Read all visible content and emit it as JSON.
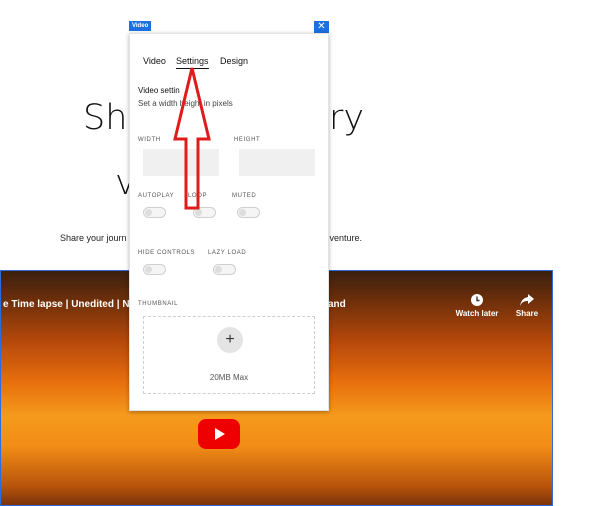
{
  "background": {
    "heading_left": "Sha",
    "heading_right": "ry",
    "heading_line2": "v",
    "subtext_left": "Share your journ",
    "subtext_right": "our venture."
  },
  "video": {
    "title": "e Time lapse | Unedited | N",
    "title_right": "and",
    "watch_later": "Watch later",
    "share": "Share"
  },
  "panel": {
    "tag": "Video",
    "close": "✕",
    "tabs": [
      "Video",
      "Settings",
      "Design"
    ],
    "active_tab": "Settings",
    "section_title": "Video settin",
    "section_subtitle": "Set a width  height in pixels",
    "width_label": "WIDTH",
    "height_label": "HEIGHT",
    "width_value": "",
    "height_value": "",
    "autoplay_label": "AUTOPLAY",
    "loop_label": "LOOP",
    "muted_label": "MUTED",
    "hide_controls_label": "HIDE CONTROLS",
    "lazy_load_label": "LAZY LOAD",
    "thumbnail_label": "THUMBNAIL",
    "thumbnail_plus": "+",
    "thumbnail_max": "20MB Max"
  },
  "colors": {
    "accent": "#1e6fe0",
    "annotation_arrow": "#e01b1b",
    "youtube_red": "#ee0000"
  }
}
